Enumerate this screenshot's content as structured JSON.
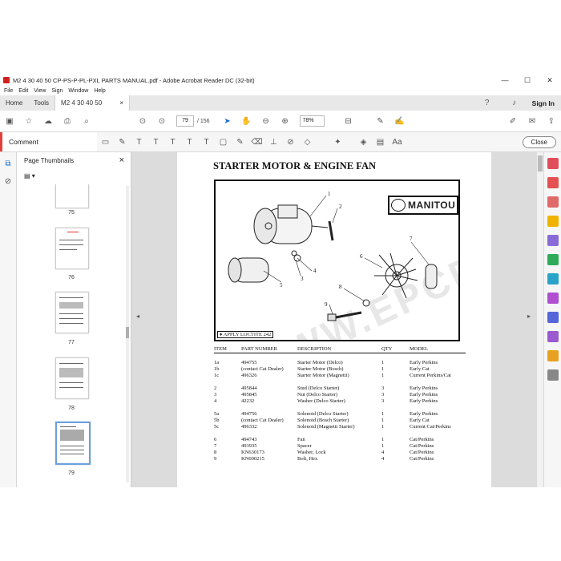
{
  "window": {
    "title": "M2 4 30 40 50 CP-PS-P-PL-PXL PARTS MANUAL.pdf - Adobe Acrobat Reader DC (32-bit)",
    "minimize": "—",
    "maximize": "☐",
    "close": "✕"
  },
  "menu": [
    "File",
    "Edit",
    "View",
    "Sign",
    "Window",
    "Help"
  ],
  "tabs": {
    "home": "Home",
    "tools": "Tools",
    "doc": "M2 4 30 40 50 CP-...",
    "doc_close": "×",
    "sign_in": "Sign In"
  },
  "toolbar": {
    "page_current": "79",
    "page_total": "/ 156",
    "zoom": "78%"
  },
  "comment_bar": {
    "label": "Comment",
    "close": "Close"
  },
  "thumbnails": {
    "header": "Page Thumbnails",
    "pages": [
      "75",
      "76",
      "77",
      "78",
      "79"
    ],
    "selected": "79"
  },
  "page": {
    "title": "STARTER MOTOR & ENGINE FAN",
    "logo": "MANITOU",
    "watermark": "WWW.EPCDEPO.COM",
    "loctite_note": "APPLY LOCTITE 242",
    "callouts": [
      "1",
      "2",
      "3",
      "4",
      "5",
      "6",
      "7",
      "8",
      "9"
    ],
    "columns": [
      "ITEM",
      "PART NUMBER",
      "DESCRIPTION",
      "QTY",
      "MODEL"
    ],
    "groups": [
      [
        [
          "1a",
          "494755",
          "Starter Motor (Delco)",
          "1",
          "Early Perkins"
        ],
        [
          "1b",
          "(contact Cat Dealer)",
          "Starter Motor (Bosch)",
          "1",
          "Early Cat"
        ],
        [
          "1c",
          "496326",
          "Starter Motor (Magnetti)",
          "1",
          "Current Perkins/Cat"
        ]
      ],
      [
        [
          "2",
          "495844",
          "Stud (Delco Starter)",
          "3",
          "Early Perkins"
        ],
        [
          "3",
          "495845",
          "Nut (Delco Starter)",
          "3",
          "Early Perkins"
        ],
        [
          "4",
          "42232",
          "Washer (Delco Starter)",
          "3",
          "Early Perkins"
        ]
      ],
      [
        [
          "5a",
          "494756",
          "Solenoid (Delco Starter)",
          "1",
          "Early Perkins"
        ],
        [
          "5b",
          "(contact Cat Dealer)",
          "Solenoid (Bosch Starter)",
          "1",
          "Early Cat"
        ],
        [
          "5c",
          "496332",
          "Solenoid (Magnetti Starter)",
          "1",
          "Current Cat/Perkins"
        ]
      ],
      [
        [
          "6",
          "494743",
          "Fan",
          "1",
          "Cat/Perkins"
        ],
        [
          "7",
          "493935",
          "Spacer",
          "1",
          "Cat/Perkins"
        ],
        [
          "8",
          "KN630173",
          "Washer, Lock",
          "4",
          "Cat/Perkins"
        ],
        [
          "9",
          "KN600215",
          "Bolt, Hex",
          "4",
          "Cat/Perkins"
        ]
      ]
    ]
  },
  "colors": {
    "accent": "#e2413b",
    "selected_thumb": "#6a9fe2"
  }
}
